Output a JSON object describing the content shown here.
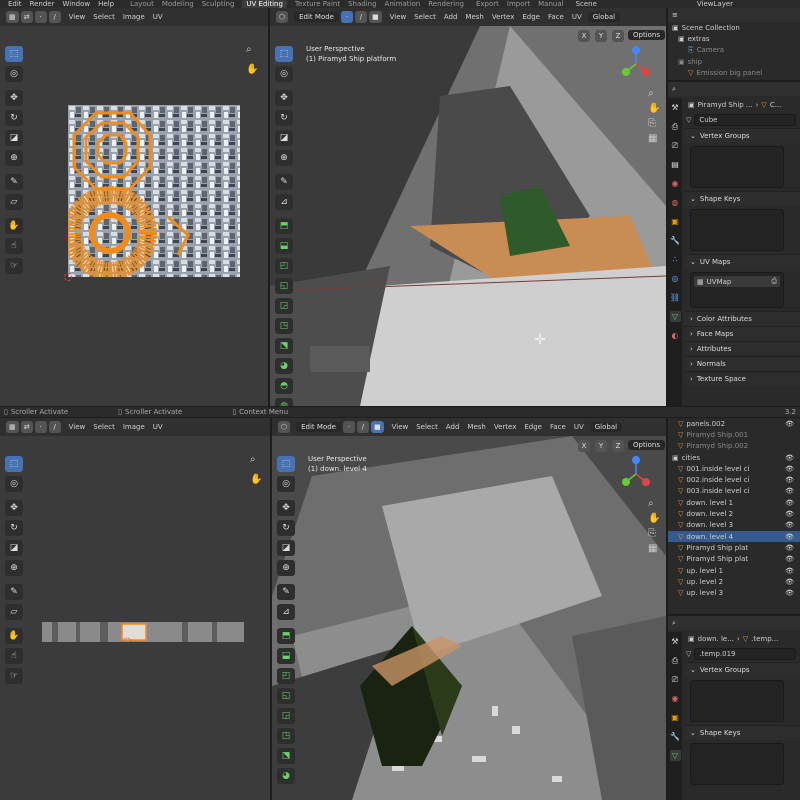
{
  "topbar": {
    "menus": [
      "Edit",
      "Render",
      "Window",
      "Help"
    ],
    "workspaces": [
      "Layout",
      "Modeling",
      "Sculpting",
      "UV Editing",
      "Texture Paint",
      "Shading",
      "Animation",
      "Rendering"
    ],
    "active_workspace": "UV Editing",
    "export": "Export",
    "import": "Import",
    "manual": "Manual",
    "scene": "Scene",
    "viewlayer": "ViewLayer"
  },
  "uv_top": {
    "menus": [
      "View",
      "Select",
      "Image",
      "UV"
    ]
  },
  "uv_bottom": {
    "menus": [
      "View",
      "Select",
      "Image",
      "UV"
    ]
  },
  "view3d_top": {
    "mode": "Edit Mode",
    "menus": [
      "View",
      "Select",
      "Add",
      "Mesh",
      "Vertex",
      "Edge",
      "Face",
      "UV"
    ],
    "orientation": "Global",
    "options": "Options",
    "perspective": "User Perspective",
    "object_label": "(1) Piramyd Ship platform"
  },
  "view3d_bottom": {
    "mode": "Edit Mode",
    "menus": [
      "View",
      "Select",
      "Add",
      "Mesh",
      "Vertex",
      "Edge",
      "Face",
      "UV"
    ],
    "orientation": "Global",
    "options": "Options",
    "perspective": "User Perspective",
    "object_label": "(1) down. level 4"
  },
  "axes": {
    "x": "X",
    "y": "Y",
    "z": "Z"
  },
  "outliner_top": {
    "root": "Scene Collection",
    "items": [
      {
        "name": "extras",
        "type": "collection"
      },
      {
        "name": "Camera",
        "type": "camera",
        "dim": true
      },
      {
        "name": "ship",
        "type": "collection",
        "dim": true
      },
      {
        "name": "Emission big panel",
        "type": "mesh",
        "dim": true
      }
    ]
  },
  "props_top": {
    "object_name": "Piramyd Ship ...",
    "data_name": "C...",
    "mesh_name": "Cube",
    "sections": [
      "Vertex Groups",
      "Shape Keys",
      "UV Maps",
      "Color Attributes",
      "Face Maps",
      "Attributes",
      "Normals",
      "Texture Space"
    ],
    "uv_map": "UVMap"
  },
  "outliner_bottom": {
    "items": [
      {
        "name": "panels.002",
        "sel": false
      },
      {
        "name": "Piramyd Ship.001",
        "sel": false,
        "dim": true
      },
      {
        "name": "Piramyd Ship.002",
        "sel": false,
        "dim": true
      },
      {
        "name": "cities",
        "sel": false,
        "collection": true
      },
      {
        "name": "001.inside level ci",
        "sel": false
      },
      {
        "name": "002.inside level ci",
        "sel": false
      },
      {
        "name": "003.inside level ci",
        "sel": false
      },
      {
        "name": "down. level 1",
        "sel": false
      },
      {
        "name": "down. level 2",
        "sel": false
      },
      {
        "name": "down. level 3",
        "sel": false
      },
      {
        "name": "down. level 4",
        "sel": true
      },
      {
        "name": "Piramyd Ship plat",
        "sel": false
      },
      {
        "name": "Piramyd Ship plat",
        "sel": false
      },
      {
        "name": "up. level 1",
        "sel": false
      },
      {
        "name": "up. level 2",
        "sel": false
      },
      {
        "name": "up. level 3",
        "sel": false
      }
    ]
  },
  "props_bottom": {
    "object_name": "down. le...",
    "data_name": ".temp...",
    "mesh_name": ".temp.019",
    "sections": [
      "Vertex Groups",
      "Shape Keys"
    ]
  },
  "statusbar": {
    "items": [
      "Scroller Activate",
      "Scroller Activate",
      "Context Menu"
    ],
    "version": "3.2"
  },
  "colors": {
    "accent": "#4772b3",
    "selection_orange": "#e88a1a",
    "header": "#303030",
    "viewport_bg": "#3a3a3a",
    "panel_bg": "#2a2a2a"
  }
}
